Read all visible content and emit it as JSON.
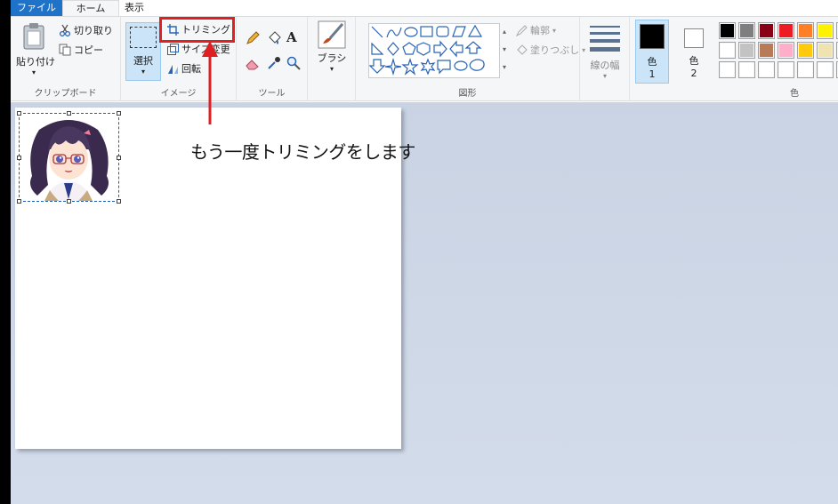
{
  "tabs": {
    "file": "ファイル",
    "home": "ホーム",
    "view": "表示"
  },
  "clipboard": {
    "paste": "貼り付け",
    "cut": "切り取り",
    "copy": "コピー",
    "group": "クリップボード"
  },
  "image": {
    "select": "選択",
    "trim": "トリミング",
    "resize": "サイズ変更",
    "rotate": "回転",
    "group": "イメージ"
  },
  "tools": {
    "group": "ツール"
  },
  "brush": {
    "label": "ブラシ"
  },
  "shapes": {
    "outline": "輪郭",
    "fill": "塗りつぶし",
    "group": "図形"
  },
  "width": {
    "label": "線の幅"
  },
  "colors": {
    "color1_label": "色",
    "color1_num": "1",
    "color2_label": "色",
    "color2_num": "2",
    "group": "色",
    "color1": "#000000",
    "color2": "#ffffff",
    "palette_row1": [
      "#000000",
      "#7f7f7f",
      "#880015",
      "#ed1c24",
      "#ff7f27",
      "#fff200",
      "#22b14c"
    ],
    "palette_row2": [
      "#ffffff",
      "#c3c3c3",
      "#b97a57",
      "#ffaec9",
      "#ffc90e",
      "#efe4b0",
      "#b5e61d"
    ],
    "palette_row3": [
      "#ffffff",
      "#ffffff",
      "#ffffff",
      "#ffffff",
      "#ffffff",
      "#ffffff",
      "#ffffff"
    ]
  },
  "annotation": {
    "text": "もう一度トリミングをします",
    "highlight_color": "#e02020"
  }
}
